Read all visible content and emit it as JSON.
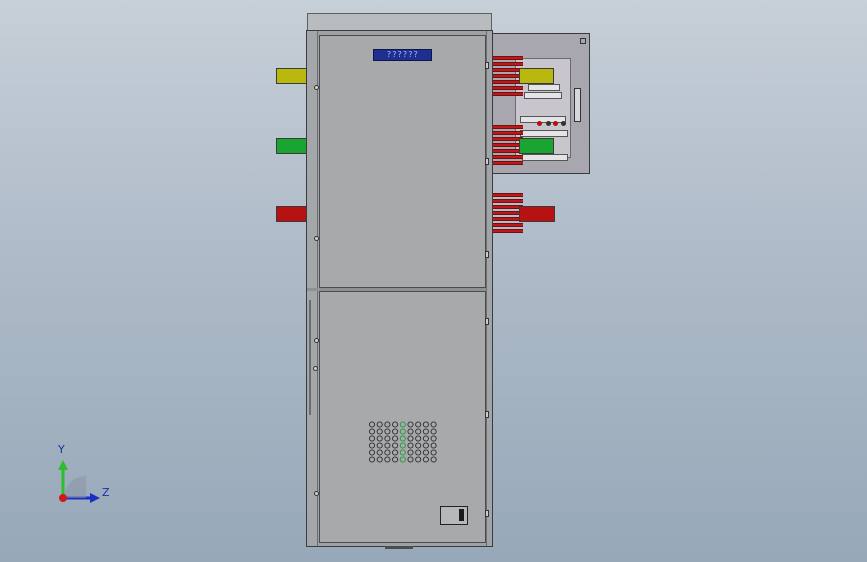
{
  "viewport": {
    "background": "gradient-blue-grey"
  },
  "cabinet": {
    "display_text": "??????",
    "colors": {
      "body": "#a7a9ab",
      "frame": "#3a3c3e"
    }
  },
  "busbars": {
    "phase_colors": {
      "L1": "#b8b80e",
      "L2": "#1aa532",
      "L3": "#b81111"
    }
  },
  "triad": {
    "y_label": "Y",
    "z_label": "Z",
    "colors": {
      "y": "#2cbf2c",
      "z": "#1a2fc0",
      "x": "#d01818"
    }
  }
}
